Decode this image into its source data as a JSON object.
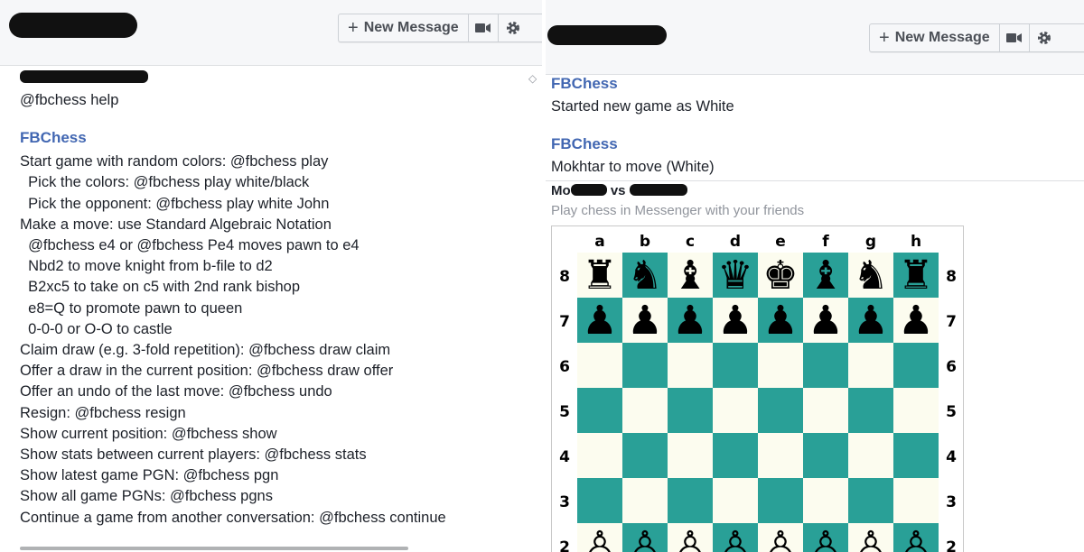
{
  "left": {
    "toolbar": {
      "new_message_label": "New Message",
      "plus_icon": "+",
      "video_icon": "video-camera-icon",
      "settings_icon": "gear-icon"
    },
    "user_message": "@fbchess help",
    "bot_sender": "FBChess",
    "help_lines": [
      "Start game with random colors: @fbchess play",
      "  Pick the colors: @fbchess play white/black",
      "  Pick the opponent: @fbchess play white John",
      "Make a move: use Standard Algebraic Notation",
      "  @fbchess e4 or @fbchess Pe4 moves pawn to e4",
      "  Nbd2 to move knight from b-file to d2",
      "  B2xc5 to take on c5 with 2nd rank bishop",
      "  e8=Q to promote pawn to queen",
      "  0-0-0 or O-O to castle",
      "Claim draw (e.g. 3-fold repetition): @fbchess draw claim",
      "Offer a draw in the current position: @fbchess draw offer",
      "Offer an undo of the last move: @fbchess undo",
      "Resign: @fbchess resign",
      "Show current position: @fbchess show",
      "Show stats between current players: @fbchess stats",
      "Show latest game PGN: @fbchess pgn",
      "Show all game PGNs: @fbchess pgns",
      "Continue a game from another conversation: @fbchess continue"
    ]
  },
  "right": {
    "toolbar": {
      "new_message_label": "New Message",
      "plus_icon": "+",
      "video_icon": "video-camera-icon",
      "settings_icon": "gear-icon"
    },
    "messages": [
      {
        "sender": "FBChess",
        "text": "Started new game as White"
      },
      {
        "sender": "FBChess",
        "text": "Mokhtar to move (White)"
      }
    ],
    "card": {
      "title_left": "Mo",
      "title_mid": "vs",
      "subtitle": "Play chess in Messenger with your friends"
    },
    "board": {
      "files": [
        "a",
        "b",
        "c",
        "d",
        "e",
        "f",
        "g",
        "h"
      ],
      "ranks": [
        "8",
        "7",
        "6",
        "5",
        "4",
        "3",
        "2"
      ],
      "rows": [
        [
          "♜",
          "♞",
          "♝",
          "♛",
          "♚",
          "♝",
          "♞",
          "♜"
        ],
        [
          "♟",
          "♟",
          "♟",
          "♟",
          "♟",
          "♟",
          "♟",
          "♟"
        ],
        [
          "",
          "",
          "",
          "",
          "",
          "",
          "",
          ""
        ],
        [
          "",
          "",
          "",
          "",
          "",
          "",
          "",
          ""
        ],
        [
          "",
          "",
          "",
          "",
          "",
          "",
          "",
          ""
        ],
        [
          "",
          "",
          "",
          "",
          "",
          "",
          "",
          ""
        ],
        [
          "♙",
          "♙",
          "♙",
          "♙",
          "♙",
          "♙",
          "♙",
          "♙"
        ]
      ],
      "light_color": "#fcfcef",
      "dark_color": "#29a097",
      "piece_color": "#000000"
    },
    "accent_color": "#4267b2"
  }
}
